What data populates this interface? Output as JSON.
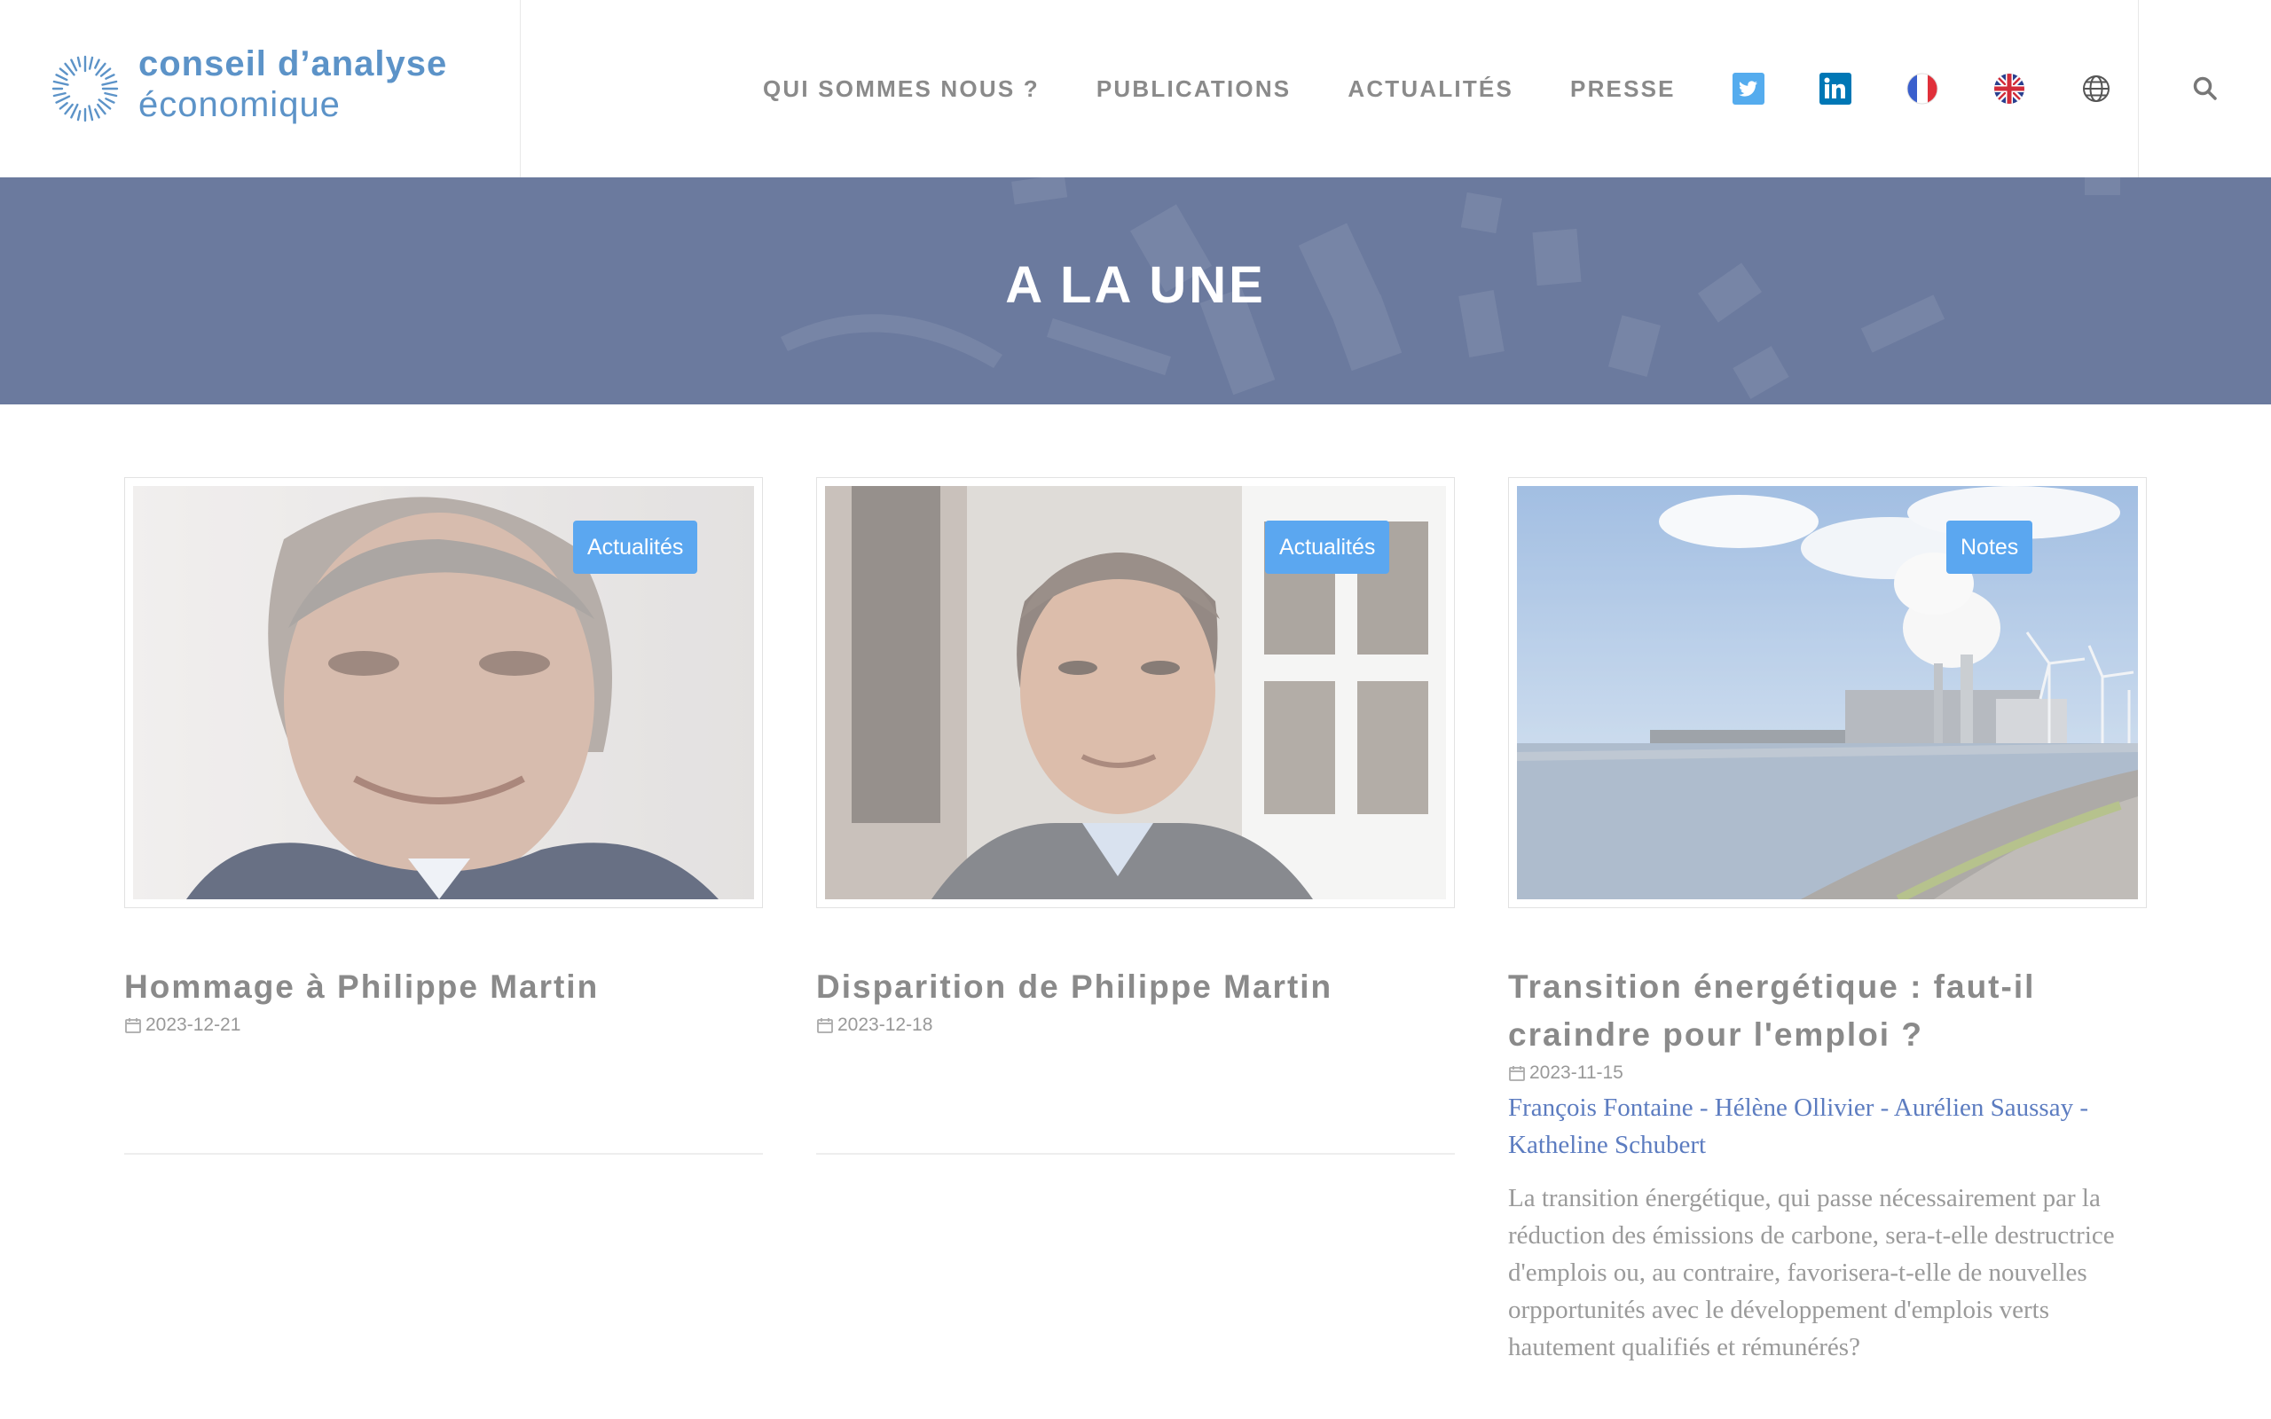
{
  "logo": {
    "line1": "conseil d’analyse",
    "line2": "économique"
  },
  "nav": {
    "items": [
      "QUI SOMMES NOUS ?",
      "PUBLICATIONS",
      "ACTUALITÉS",
      "PRESSE"
    ],
    "icons": [
      "twitter-icon",
      "linkedin-icon",
      "french-flag-icon",
      "uk-flag-icon",
      "globe-icon"
    ]
  },
  "colors": {
    "brand": "#5c93c8",
    "banner": "#6b7a9e",
    "badge": "#5ba7f0",
    "link": "#5c7cc0"
  },
  "banner": {
    "title": "A LA UNE"
  },
  "cards": [
    {
      "badge": "Actualités",
      "title": "Hommage à Philippe Martin",
      "date": "2023-12-21"
    },
    {
      "badge": "Actualités",
      "title": "Disparition de Philippe Martin",
      "date": "2023-12-18"
    },
    {
      "badge": "Notes",
      "title_line1": "Transition énergétique : faut-il",
      "title_line2": "craindre pour l'emploi ?",
      "date": "2023-11-15",
      "authors": [
        "François Fontaine",
        "Hélène Ollivier",
        "Aurélien Saussay",
        "Katheline Schubert"
      ],
      "author_separator": " - ",
      "excerpt": "La transition énergétique, qui passe nécessairement par la réduction des émissions de carbone, sera-t-elle destructrice d'emplois ou, au contraire, favorisera-t-elle de nouvelles orpportunités avec le développement d'emplois verts hautement qualifiés et rémunérés?"
    }
  ]
}
